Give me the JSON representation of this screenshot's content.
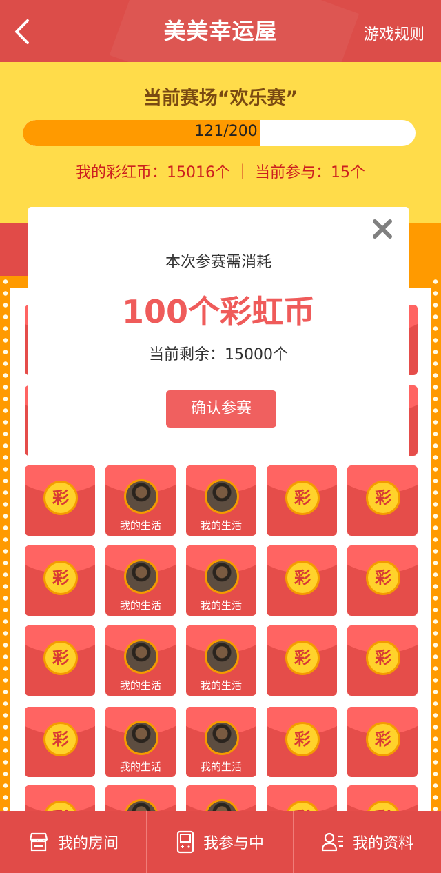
{
  "header": {
    "title": "美美幸运屋",
    "rules_label": "游戏规则"
  },
  "arena": {
    "title": "当前赛场“欢乐赛”",
    "progress_text": "121/200",
    "progress_current": 121,
    "progress_total": 200,
    "stats_text": "我的彩红币：15016个 ｜ 当前参与：15个"
  },
  "grid": {
    "coin_label": "彩",
    "player_label": "我的生活",
    "columns": [
      "coin",
      "player",
      "player",
      "coin",
      "coin"
    ]
  },
  "modal": {
    "subtitle": "本次参赛需消耗",
    "cost": "100个彩虹币",
    "remaining": "当前剩余：15000个",
    "confirm_label": "确认参赛"
  },
  "tabbar": {
    "tabs": [
      {
        "label": "我的房间",
        "icon": "store-icon"
      },
      {
        "label": "我参与中",
        "icon": "game-console-icon"
      },
      {
        "label": "我的资料",
        "icon": "profile-icon"
      }
    ]
  },
  "colors": {
    "primary_red": "#e14b48",
    "panel_yellow": "#ffdc4a",
    "progress_orange": "#ff9a00",
    "cost_red": "#ef5b5a"
  }
}
